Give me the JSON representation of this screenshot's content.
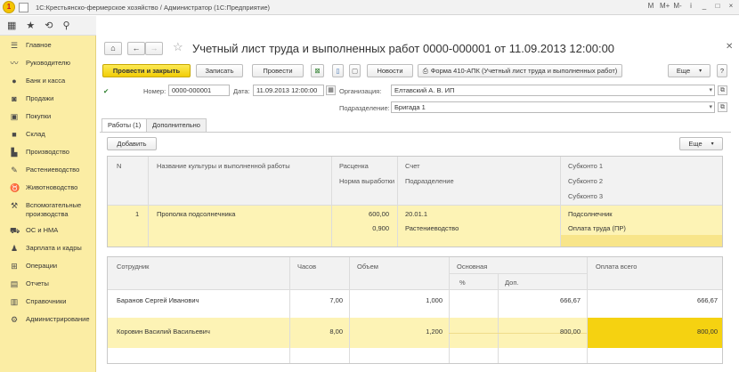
{
  "window": {
    "title": "1С:Крестьянско-фермерское хозяйство / Администратор (1С:Предприятие)",
    "controls": [
      "M",
      "M+",
      "M-",
      "i",
      "_",
      "□",
      "×"
    ]
  },
  "sidebar": {
    "items": [
      {
        "label": "Главное",
        "icon": "menu-icon"
      },
      {
        "label": "Руководителю",
        "icon": "chart-icon"
      },
      {
        "label": "Банк и касса",
        "icon": "bank-icon"
      },
      {
        "label": "Продажи",
        "icon": "cart-icon"
      },
      {
        "label": "Покупки",
        "icon": "basket-icon"
      },
      {
        "label": "Склад",
        "icon": "box-icon"
      },
      {
        "label": "Производство",
        "icon": "factory-icon"
      },
      {
        "label": "Растениеводство",
        "icon": "plant-icon"
      },
      {
        "label": "Животноводство",
        "icon": "cow-icon"
      },
      {
        "label": "Вспомогательные производства",
        "icon": "tools-icon"
      },
      {
        "label": "ОС и НМА",
        "icon": "car-icon"
      },
      {
        "label": "Зарплата и кадры",
        "icon": "people-icon"
      },
      {
        "label": "Операции",
        "icon": "operations-icon"
      },
      {
        "label": "Отчеты",
        "icon": "report-icon"
      },
      {
        "label": "Справочники",
        "icon": "book-icon"
      },
      {
        "label": "Администрирование",
        "icon": "gear-icon"
      }
    ]
  },
  "document": {
    "title": "Учетный лист труда и выполненных работ 0000-000001 от 11.09.2013 12:00:00"
  },
  "toolbar": {
    "post_close": "Провести и закрыть",
    "save": "Записать",
    "post": "Провести",
    "news": "Новости",
    "print_form": "Форма 410-АПК (Учетный лист труда и выполненных работ)",
    "more": "Еще"
  },
  "form": {
    "number_label": "Номер:",
    "number_value": "0000-000001",
    "date_label": "Дата:",
    "date_value": "11.09.2013 12:00:00",
    "org_label": "Организация:",
    "org_value": "Елтавский А. В. ИП",
    "dept_label": "Подразделение:",
    "dept_value": "Бригада 1"
  },
  "tabs": [
    {
      "label": "Работы (1)",
      "active": true
    },
    {
      "label": "Дополнительно",
      "active": false
    }
  ],
  "works_toolbar": {
    "add": "Добавить",
    "more": "Еще"
  },
  "works_table": {
    "headers": {
      "n": "N",
      "culture": "Название культуры и выполненной работы",
      "rate": "Расценка",
      "norm": "Норма выработки",
      "account": "Счет",
      "dept": "Подразделение",
      "subconto1": "Субконто 1",
      "subconto2": "Субконто 2",
      "subconto3": "Субконто 3"
    },
    "row": {
      "n": "1",
      "culture": "Прополка подсолнечника",
      "rate": "600,00",
      "norm": "0,900",
      "account": "20.01.1",
      "dept": "Растениеводство",
      "subconto1": "Подсолнечник",
      "subconto2": "Оплата труда (ПР)"
    }
  },
  "workers_table": {
    "headers": {
      "employee": "Сотрудник",
      "hours": "Часов",
      "volume": "Объем",
      "main": "Основная",
      "percent": "%",
      "extra": "Доп.",
      "total": "Оплата всего"
    },
    "rows": [
      {
        "employee": "Баранов Сергей Иванович",
        "hours": "7,00",
        "volume": "1,000",
        "main": "666,67",
        "total": "666,67"
      },
      {
        "employee": "Коровин Василий Васильевич",
        "hours": "8,00",
        "volume": "1,200",
        "main": "800,00",
        "total": "800,00"
      }
    ]
  },
  "colors": {
    "sidebar_bg": "#fbeda4",
    "primary_button": "#f2cd05",
    "selected_row": "#fdf3b5",
    "active_cell": "#f5d211"
  }
}
